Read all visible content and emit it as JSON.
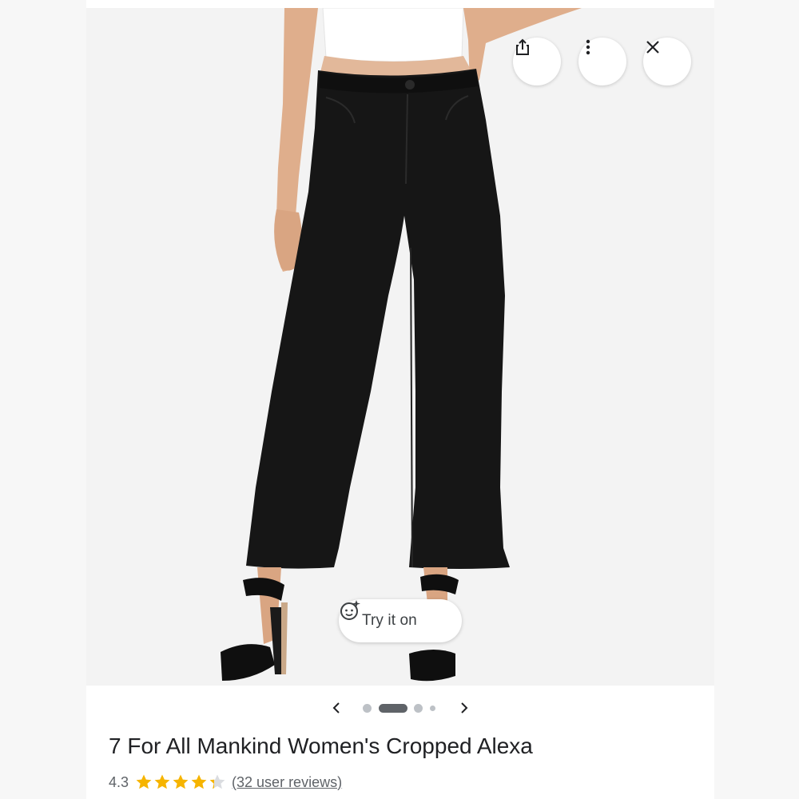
{
  "actions": {
    "share_icon": "share-icon",
    "more_icon": "more-vert-icon",
    "close_icon": "close-icon"
  },
  "try_on": {
    "label": "Try it on",
    "icon": "try-on-face-sparkle-icon"
  },
  "carousel": {
    "prev_icon": "chevron-left-icon",
    "next_icon": "chevron-right-icon",
    "image_count": 4,
    "active_index": 1
  },
  "product": {
    "title": "7 For All Mankind Women's Cropped Alexa",
    "rating": "4.3",
    "rating_value": 4.3,
    "rating_max": 5,
    "reviews_link": "(32 user reviews)"
  },
  "colors": {
    "star": "#f6b400",
    "star_empty": "#dadce0",
    "text_primary": "#202124",
    "text_secondary": "#5f6368",
    "dot_active": "#5f6368",
    "dot_inactive": "#bdc1c6"
  }
}
